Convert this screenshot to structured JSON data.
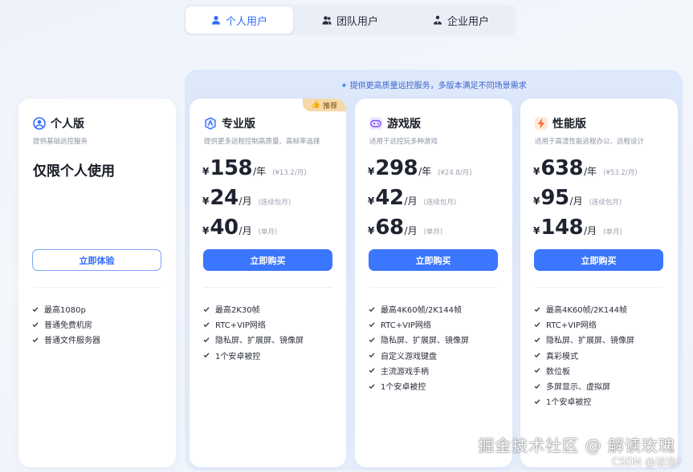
{
  "tabs": [
    {
      "label": "个人用户",
      "icon": "user-icon",
      "active": true
    },
    {
      "label": "团队用户",
      "icon": "team-icon",
      "active": false
    },
    {
      "label": "企业用户",
      "icon": "enterprise-icon",
      "active": false
    }
  ],
  "promo": "提供更高质量远控服务，多版本满足不同场景需求",
  "colors": {
    "accent": "#3b76ff",
    "badge": "#f6d9a8"
  },
  "plans": [
    {
      "name": "个人版",
      "icon": "person-circle-icon",
      "desc": "提供基础远控服务",
      "headline": "仅限个人使用",
      "button": "立即体验",
      "features": [
        "最高1080p",
        "普通免费机房",
        "普通文件服务器"
      ]
    },
    {
      "name": "专业版",
      "icon": "pro-shield-icon",
      "badge": "推荐",
      "desc": "提供更多远程控制高质量、高帧率选择",
      "prices": [
        {
          "cur": "¥",
          "num": "158",
          "unit": "/年",
          "note": "(¥13.2/月)"
        },
        {
          "cur": "¥",
          "num": "24",
          "unit": "/月",
          "note": "(连续包月)"
        },
        {
          "cur": "¥",
          "num": "40",
          "unit": "/月",
          "note": "(单月)"
        }
      ],
      "button": "立即购买",
      "features": [
        "最高2K30帧",
        "RTC+VIP网络",
        "隐私屏、扩展屏、镜像屏",
        "1个安卓被控"
      ]
    },
    {
      "name": "游戏版",
      "icon": "gamepad-icon",
      "desc": "适用于远控玩多种游戏",
      "prices": [
        {
          "cur": "¥",
          "num": "298",
          "unit": "/年",
          "note": "(¥24.8/月)"
        },
        {
          "cur": "¥",
          "num": "42",
          "unit": "/月",
          "note": "(连续包月)"
        },
        {
          "cur": "¥",
          "num": "68",
          "unit": "/月",
          "note": "(单月)"
        }
      ],
      "button": "立即购买",
      "features": [
        "最高4K60帧/2K144帧",
        "RTC+VIP网络",
        "隐私屏、扩展屏、镜像屏",
        "自定义游戏键盘",
        "主流游戏手柄",
        "1个安卓被控"
      ]
    },
    {
      "name": "性能版",
      "icon": "lightning-icon",
      "desc": "适用于高清性能远程办公、远程设计",
      "prices": [
        {
          "cur": "¥",
          "num": "638",
          "unit": "/年",
          "note": "(¥53.2/月)"
        },
        {
          "cur": "¥",
          "num": "95",
          "unit": "/月",
          "note": "(连续包月)"
        },
        {
          "cur": "¥",
          "num": "148",
          "unit": "/月",
          "note": "(单月)"
        }
      ],
      "button": "立即购买",
      "features": [
        "最高4K60帧/2K144帧",
        "RTC+VIP网络",
        "隐私屏、扩展屏、镜像屏",
        "真彩模式",
        "数位板",
        "多屏显示、虚拟屏",
        "1个安卓被控"
      ]
    }
  ],
  "watermark": {
    "line1": "掘金技术社区 @ 解读玫瑰",
    "line2": "CSDN @洁洁！"
  }
}
